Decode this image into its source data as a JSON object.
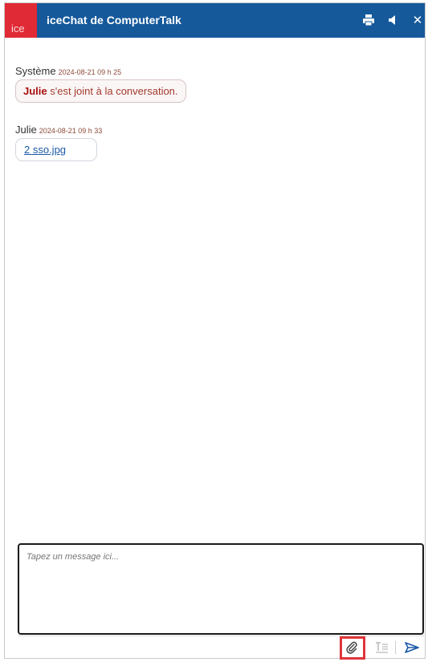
{
  "titlebar": {
    "logo_text": "ice",
    "title": "iceChat de ComputerTalk"
  },
  "messages": [
    {
      "sender": "Système",
      "time": "2024-08-21 09 h 25",
      "content_name": "Julie",
      "content_text": " s'est joint à la conversation."
    },
    {
      "sender": "Julie",
      "time": "2024-08-21 09 h 33",
      "file": "2 sso.jpg"
    }
  ],
  "compose": {
    "placeholder": "Tapez un message ici..."
  },
  "icons": {
    "print": "print-icon",
    "sound": "speaker-icon",
    "close": "close-icon",
    "attach": "paperclip-icon",
    "format": "text-format-icon",
    "send": "send-icon"
  },
  "colors": {
    "titlebar": "#15599b",
    "logo": "#e02a36",
    "highlight": "#e0353b"
  }
}
